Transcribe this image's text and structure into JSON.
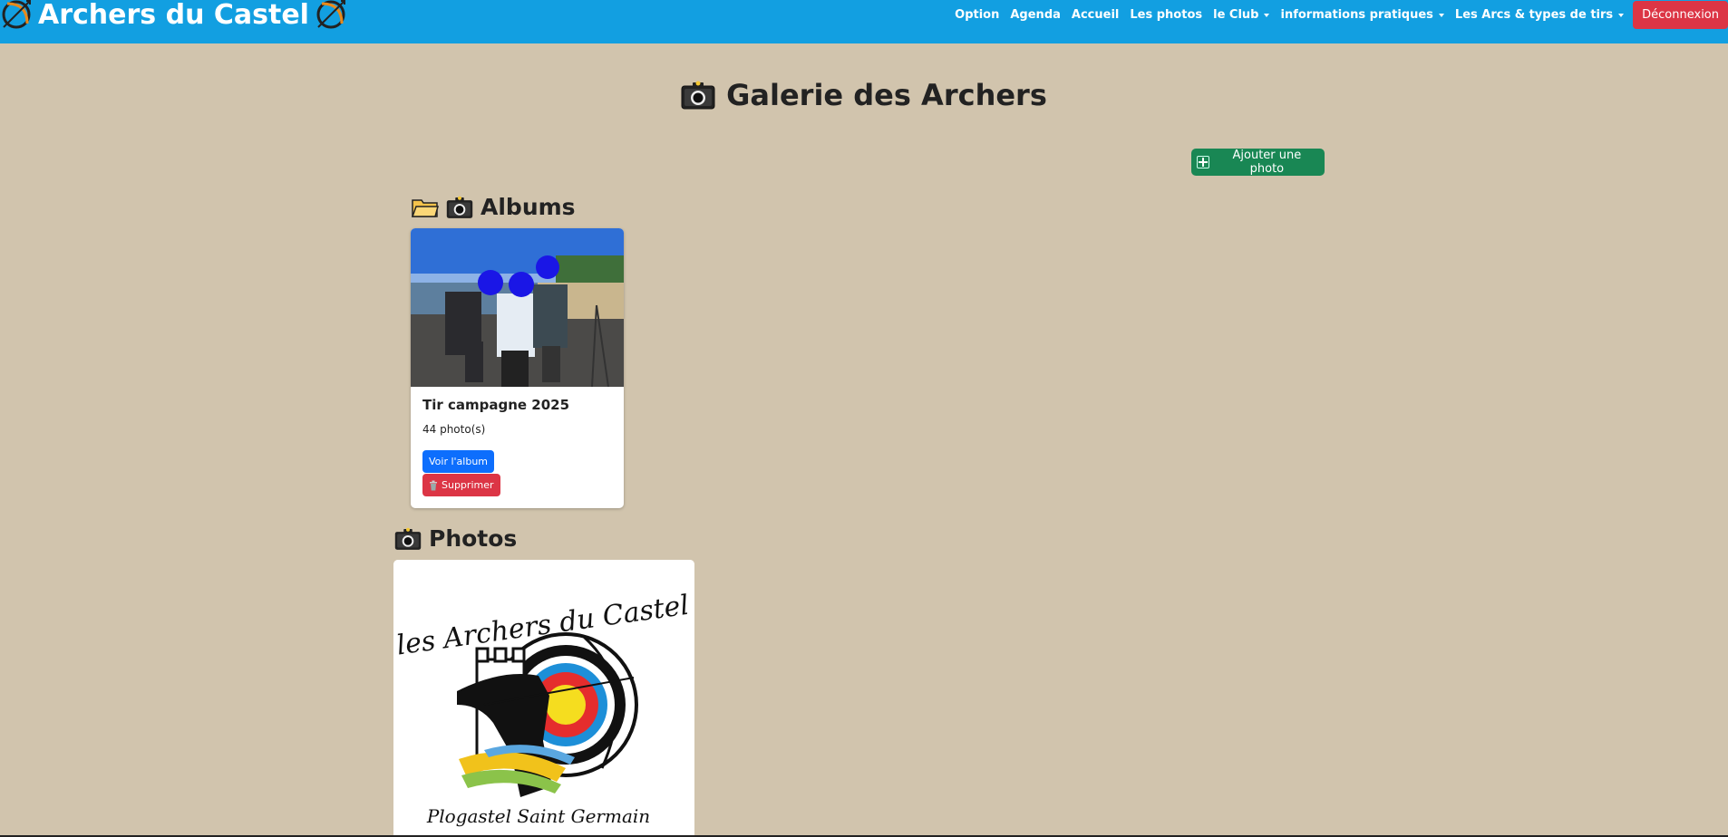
{
  "navbar": {
    "brand": "Archers du Castel",
    "brand_icon": "bow-arrow-icon",
    "links": [
      {
        "label": "Option",
        "dropdown": false
      },
      {
        "label": "Agenda",
        "dropdown": false
      },
      {
        "label": "Accueil",
        "dropdown": false
      },
      {
        "label": "Les photos",
        "dropdown": false
      },
      {
        "label": "le Club",
        "dropdown": true
      },
      {
        "label": "informations pratiques",
        "dropdown": true
      },
      {
        "label": "Les Arcs & types de tirs",
        "dropdown": true
      }
    ],
    "logout_label": "Déconnexion",
    "colors": {
      "background": "#129fe1",
      "logout": "#dc3545"
    }
  },
  "page": {
    "title": "Galerie des Archers",
    "title_icon": "camera-icon",
    "background": "#d1c4ad",
    "add_photo_label": "Ajouter une photo",
    "add_photo_color": "#198754"
  },
  "albums": {
    "heading": "Albums",
    "heading_icons": [
      "folder-icon",
      "camera-icon"
    ],
    "items": [
      {
        "name": "Tir campagne 2025",
        "count": "44 photo(s)",
        "view_label": "Voir l'album",
        "delete_label": "Supprimer",
        "delete_icon": "trash-icon"
      }
    ]
  },
  "photos": {
    "heading": "Photos",
    "heading_icon": "camera-icon",
    "items": [
      {
        "logo_top_text": "les Archers du Castel",
        "logo_bottom_text": "Plogastel Saint Germain"
      }
    ]
  }
}
